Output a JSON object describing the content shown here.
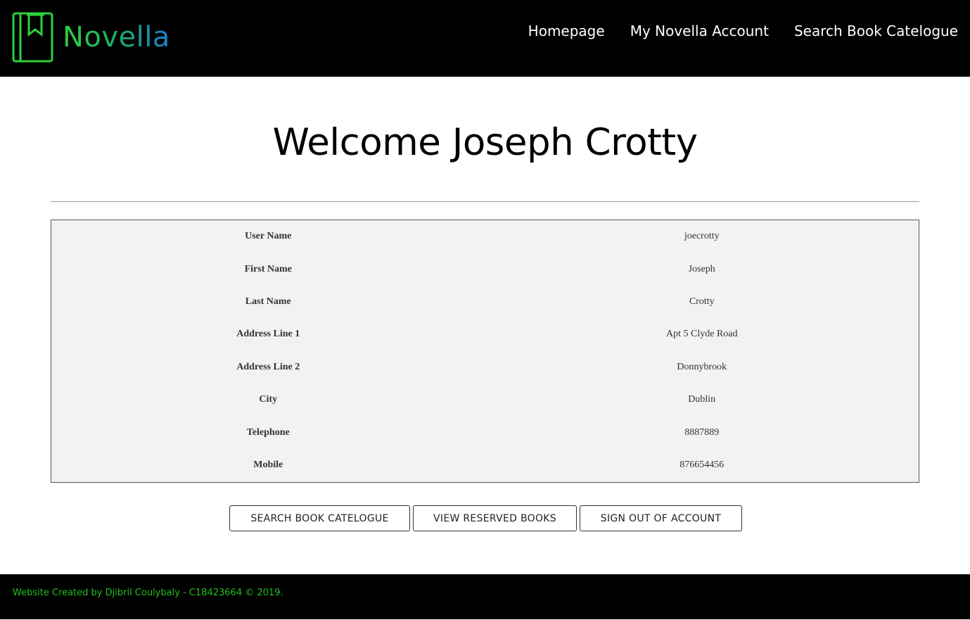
{
  "header": {
    "logo_text": "Novella",
    "nav": [
      {
        "label": "Homepage"
      },
      {
        "label": "My Novella Account"
      },
      {
        "label": "Search Book Catelogue"
      }
    ]
  },
  "main": {
    "title": "Welcome Joseph Crotty",
    "details": [
      {
        "label": "User Name",
        "value": "joecrotty"
      },
      {
        "label": "First Name",
        "value": "Joseph"
      },
      {
        "label": "Last Name",
        "value": "Crotty"
      },
      {
        "label": "Address Line 1",
        "value": "Apt 5 Clyde Road"
      },
      {
        "label": "Address Line 2",
        "value": "Donnybrook"
      },
      {
        "label": "City",
        "value": "Dublin"
      },
      {
        "label": "Telephone",
        "value": "8887889"
      },
      {
        "label": "Mobile",
        "value": "876654456"
      }
    ],
    "buttons": {
      "search": "SEARCH BOOK CATELOGUE",
      "reserved": "VIEW RESERVED BOOKS",
      "signout": "SIGN OUT OF ACCOUNT"
    }
  },
  "footer": {
    "text": "Website Created by Djibril Coulybaly - C18423664 © 2019."
  },
  "colors": {
    "header_bg": "#000000",
    "logo_green": "#2bd13a",
    "logo_blue": "#1a7fd4",
    "table_bg": "#f2f2f2",
    "footer_text": "#22c01e"
  },
  "icons": {
    "logo": "book-bookmark-icon"
  }
}
